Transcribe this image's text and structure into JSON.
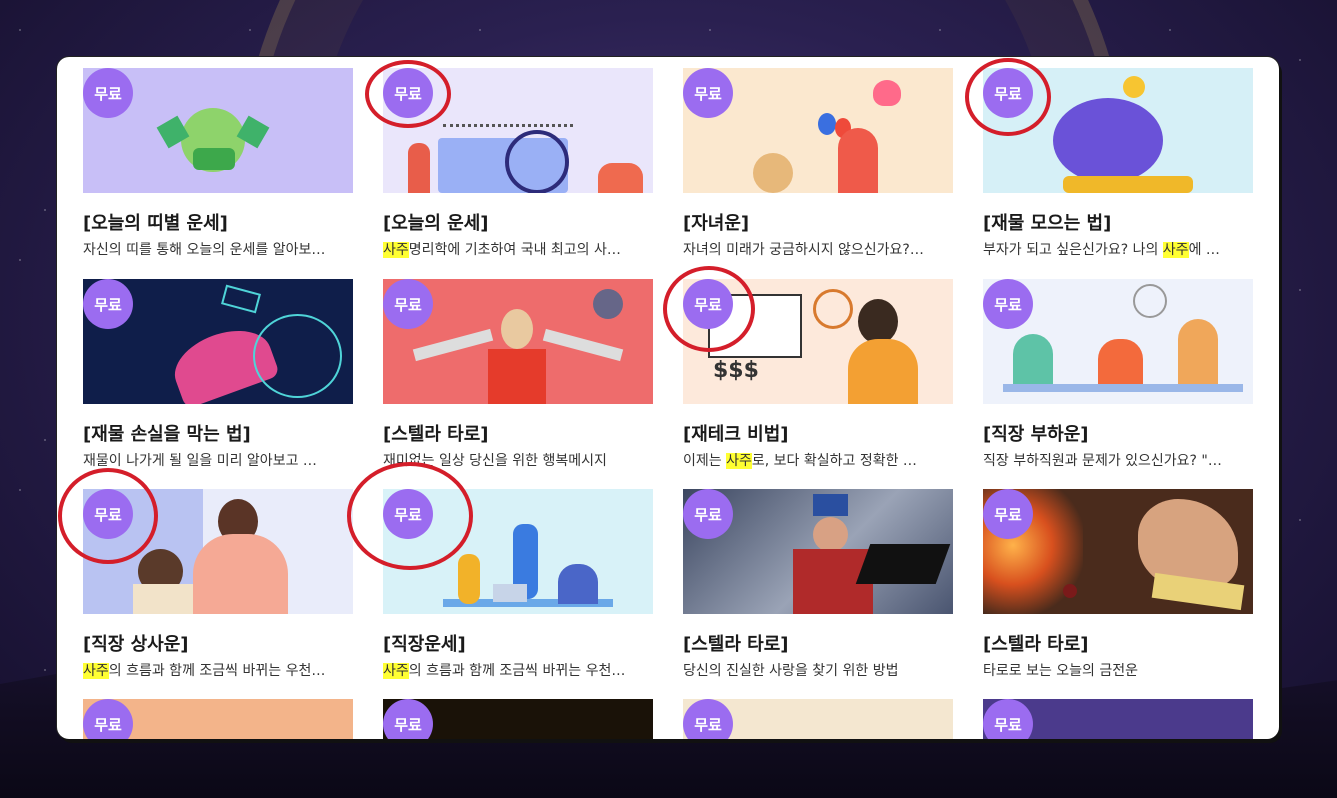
{
  "badge_label": "무료",
  "cards": [
    {
      "title": "[오늘의 띠별 운세]",
      "desc": "자신의 띠를 통해 오늘의 운세를 알아보…",
      "desc_hl": "",
      "desc_rest": ""
    },
    {
      "title": "[오늘의 운세]",
      "desc": "",
      "desc_hl": "사주",
      "desc_rest": "명리학에 기초하여 국내 최고의 사…"
    },
    {
      "title": "[자녀운]",
      "desc": "자녀의 미래가 궁금하시지 않으신가요?…",
      "desc_hl": "",
      "desc_rest": ""
    },
    {
      "title": "[재물 모으는 법]",
      "desc": "부자가 되고 싶은신가요? 나의 ",
      "desc_hl": "사주",
      "desc_rest": "에 …"
    },
    {
      "title": "[재물 손실을 막는 법]",
      "desc": "재물이 나가게 될 일을 미리 알아보고 …",
      "desc_hl": "",
      "desc_rest": ""
    },
    {
      "title": "[스텔라 타로]",
      "desc": "재미없는 일상 당신을 위한 행복메시지",
      "desc_hl": "",
      "desc_rest": ""
    },
    {
      "title": "[재테크 비법]",
      "desc": "이제는 ",
      "desc_hl": "사주",
      "desc_rest": "로, 보다 확실하고 정확한 …"
    },
    {
      "title": "[직장 부하운]",
      "desc": "직장 부하직원과 문제가 있으신가요? \"…",
      "desc_hl": "",
      "desc_rest": ""
    },
    {
      "title": "[직장 상사운]",
      "desc": "",
      "desc_hl": "사주",
      "desc_rest": "의 흐름과 함께 조금씩 바뀌는 우천…"
    },
    {
      "title": "[직장운세]",
      "desc": "",
      "desc_hl": "사주",
      "desc_rest": "의 흐름과 함께 조금씩 바뀌는 우천…"
    },
    {
      "title": "[스텔라 타로]",
      "desc": "당신의 진실한 사랑을 찾기 위한 방법",
      "desc_hl": "",
      "desc_rest": ""
    },
    {
      "title": "[스텔라 타로]",
      "desc": "타로로 보는 오늘의 금전운",
      "desc_hl": "",
      "desc_rest": ""
    }
  ],
  "colors": {
    "badge": "#9b6cf0",
    "highlight": "#ffff33",
    "annotation_circle": "#d41e2a"
  }
}
